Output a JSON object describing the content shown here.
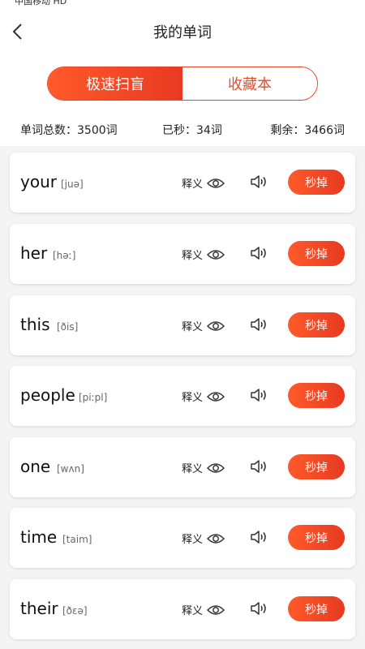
{
  "status": {
    "carrier": "中国移动 HD"
  },
  "header": {
    "title": "我的单词",
    "back_icon": "chevron-left-icon"
  },
  "tabs": {
    "active": "极速扫盲",
    "inactive": "收藏本"
  },
  "stats": {
    "total": "单词总数：3500词",
    "done": "已秒：34词",
    "remaining": "剩余：3466词"
  },
  "colors": {
    "accent": "#ec4325",
    "list_bg": "#f4f4f4"
  },
  "words": [
    {
      "word": "your",
      "phonetic": "[juə]",
      "meaning_label": "释义",
      "kill_label": "秒掉"
    },
    {
      "word": "her",
      "phonetic": "[həː]",
      "meaning_label": "释义",
      "kill_label": "秒掉"
    },
    {
      "word": "this",
      "phonetic": "[ðis]",
      "meaning_label": "释义",
      "kill_label": "秒掉"
    },
    {
      "word": "people",
      "phonetic": "[piːpl]",
      "meaning_label": "释义",
      "kill_label": "秒掉"
    },
    {
      "word": "one",
      "phonetic": "[wʌn]",
      "meaning_label": "释义",
      "kill_label": "秒掉"
    },
    {
      "word": "time",
      "phonetic": "[taim]",
      "meaning_label": "释义",
      "kill_label": "秒掉"
    },
    {
      "word": "their",
      "phonetic": "[ðɛə]",
      "meaning_label": "释义",
      "kill_label": "秒掉"
    }
  ]
}
